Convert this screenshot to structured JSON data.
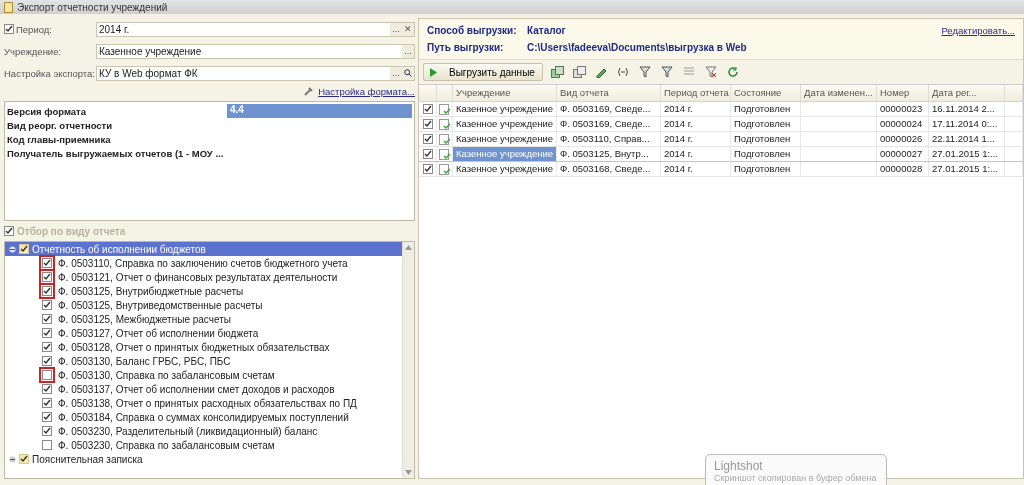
{
  "window": {
    "title": "Экспорт отчетности учреждений"
  },
  "fields": [
    {
      "label": "Период:",
      "value": "2014 г.",
      "checked": true,
      "buttons": [
        {
          "kind": "choice",
          "text": "..."
        },
        {
          "kind": "clear",
          "text": "✕"
        }
      ]
    },
    {
      "label": "Учреждение:",
      "value": "Казенное учреждение",
      "buttons": [
        {
          "kind": "choice",
          "text": "..."
        }
      ]
    },
    {
      "label": "Настройка экспорта:",
      "value": "КУ в Web формат ФК",
      "buttons": [
        {
          "kind": "choice",
          "text": "..."
        },
        {
          "kind": "search"
        }
      ]
    }
  ],
  "format_link": "Настройка формата...",
  "params": [
    {
      "name": "Версия формата",
      "value": "4.4",
      "selected": true
    },
    {
      "name": "Вид реорг. отчетности",
      "selected": false
    },
    {
      "name": "Код главы-приемника",
      "selected": false
    },
    {
      "name": "Получатель выгружаемых отчетов (1 - МОУ ...",
      "selected": false
    }
  ],
  "filter": {
    "label": "Отбор по виду отчета",
    "checked": true
  },
  "tree": [
    {
      "label": "Отчетность об исполнении бюджетов",
      "checked": true,
      "expanded": true,
      "selected": true,
      "children": [
        {
          "label": "Ф. 0503110, Справка по заключению счетов бюджетного учета",
          "checked": true,
          "highlighted": true
        },
        {
          "label": "Ф. 0503121, Отчет о финансовых результатах деятельности",
          "checked": true,
          "highlighted": true
        },
        {
          "label": "Ф. 0503125, Внутрибюджетные расчеты",
          "checked": true,
          "highlighted": true
        },
        {
          "label": "Ф. 0503125, Внутриведомственные расчеты",
          "checked": true,
          "highlighted": false
        },
        {
          "label": "Ф. 0503125, Межбюджетные расчеты",
          "checked": true,
          "highlighted": false
        },
        {
          "label": "Ф. 0503127, Отчет об исполнении бюджета",
          "checked": true,
          "highlighted": false
        },
        {
          "label": "Ф. 0503128, Отчет о принятых бюджетных обязательствах",
          "checked": true,
          "highlighted": false
        },
        {
          "label": "Ф. 0503130, Баланс ГРБС, РБС, ПБС",
          "checked": true,
          "highlighted": false
        },
        {
          "label": "Ф. 0503130, Справка по забалансовым счетам",
          "checked": false,
          "highlighted": true
        },
        {
          "label": "Ф. 0503137, Отчет об исполнении смет доходов и расходов",
          "checked": true,
          "highlighted": false
        },
        {
          "label": "Ф. 0503138, Отчет о принятых расходных обязательствах по ПД",
          "checked": true,
          "highlighted": false
        },
        {
          "label": "Ф. 0503184, Справка о суммах консолидируемых поступлений",
          "checked": true,
          "highlighted": false
        },
        {
          "label": "Ф. 0503230, Разделительный (ликвидационный) баланс",
          "checked": true,
          "highlighted": false
        },
        {
          "label": "Ф. 0503230, Справка по забалансовым счетам",
          "checked": false,
          "highlighted": false
        }
      ]
    },
    {
      "label": "Пояснительная записка",
      "checked": true,
      "expanded": true,
      "selected": false
    }
  ],
  "export_info": [
    {
      "label": "Способ выгрузки:",
      "value": "Каталог"
    },
    {
      "label": "Путь выгрузки:",
      "value": "C:\\Users\\fadeeva\\Documents\\выгрузка в Web"
    }
  ],
  "edit_link": "Редактировать...",
  "export_button": "Выгрузить данные",
  "grid": {
    "columns": [
      "Учреждение",
      "Вид отчета",
      "Период отчета",
      "Состояние",
      "Дата изменен...",
      "Номер",
      "Дата рег..."
    ],
    "rows": [
      {
        "checked": true,
        "selected": false,
        "cells": [
          "Казенное учреждение",
          "Ф. 0503169, Сведе...",
          "2014 г.",
          "Подготовлен",
          "",
          "00000023",
          "16.11.2014 2..."
        ]
      },
      {
        "checked": true,
        "selected": false,
        "cells": [
          "Казенное учреждение",
          "Ф. 0503169, Сведе...",
          "2014 г.",
          "Подготовлен",
          "",
          "00000024",
          "17.11.2014 0:..."
        ]
      },
      {
        "checked": true,
        "selected": false,
        "cells": [
          "Казенное учреждение",
          "Ф. 0503110, Справ...",
          "2014 г.",
          "Подготовлен",
          "",
          "00000026",
          "22.11.2014 1..."
        ]
      },
      {
        "checked": true,
        "selected": true,
        "cells": [
          "Казенное учреждение",
          "Ф. 0503125, Внутр...",
          "2014 г.",
          "Подготовлен",
          "",
          "00000027",
          "27.01.2015 1:..."
        ]
      },
      {
        "checked": true,
        "selected": false,
        "cells": [
          "Казенное учреждение",
          "Ф. 0503168, Сведе...",
          "2014 г.",
          "Подготовлен",
          "",
          "00000028",
          "27.01.2015 1:..."
        ]
      }
    ]
  },
  "toast": {
    "title": "Lightshot",
    "text": "Скриншот скопирован в буфер обмена"
  }
}
